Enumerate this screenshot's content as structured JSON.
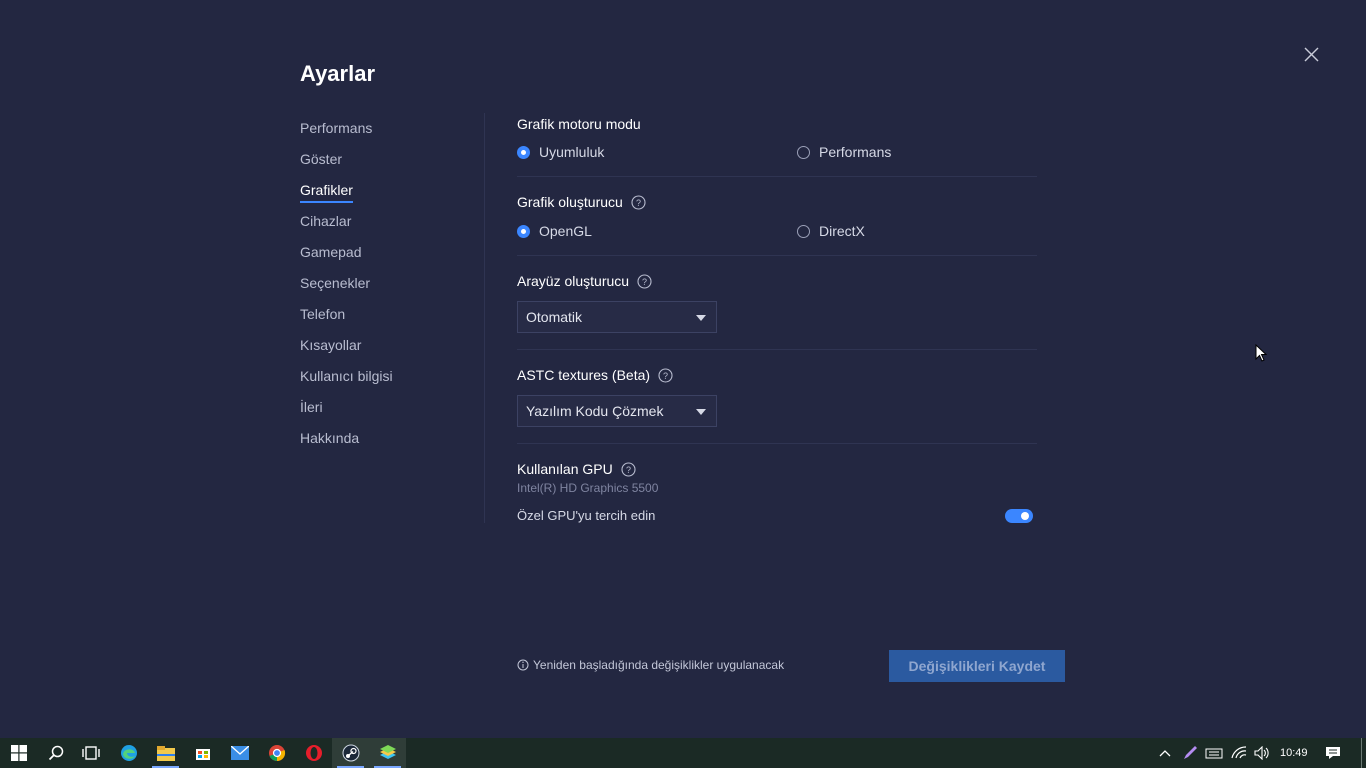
{
  "settings": {
    "title": "Ayarlar",
    "nav": [
      {
        "label": "Performans",
        "active": false
      },
      {
        "label": "Göster",
        "active": false
      },
      {
        "label": "Grafikler",
        "active": true
      },
      {
        "label": "Cihazlar",
        "active": false
      },
      {
        "label": "Gamepad",
        "active": false
      },
      {
        "label": "Seçenekler",
        "active": false
      },
      {
        "label": "Telefon",
        "active": false
      },
      {
        "label": "Kısayollar",
        "active": false
      },
      {
        "label": "Kullanıcı bilgisi",
        "active": false
      },
      {
        "label": "İleri",
        "active": false
      },
      {
        "label": "Hakkında",
        "active": false
      }
    ],
    "engine_mode": {
      "title": "Grafik motoru modu",
      "options": [
        "Uyumluluk",
        "Performans"
      ],
      "selected": "Uyumluluk"
    },
    "renderer": {
      "title": "Grafik oluşturucu",
      "options": [
        "OpenGL",
        "DirectX"
      ],
      "selected": "OpenGL"
    },
    "ui_renderer": {
      "title": "Arayüz oluşturucu",
      "value": "Otomatik"
    },
    "astc": {
      "title": "ASTC textures (Beta)",
      "value": "Yazılım Kodu Çözmek"
    },
    "gpu": {
      "title": "Kullanılan GPU",
      "name": "Intel(R) HD Graphics 5500",
      "prefer_label": "Özel GPU'yu tercih edin",
      "prefer_enabled": true
    },
    "footer_note": "Yeniden başladığında değişiklikler uygulanacak",
    "save_label": "Değişiklikleri Kaydet"
  },
  "colors": {
    "background": "#232741",
    "accent": "#3b86ff",
    "save_button": "#2b5aa0",
    "taskbar": "#1b2a25"
  },
  "taskbar": {
    "apps": [
      "windows-start-icon",
      "search-icon",
      "task-view-icon",
      "edge-icon",
      "file-explorer-icon",
      "store-icon",
      "mail-icon",
      "chrome-icon",
      "opera-icon",
      "steam-icon",
      "bluestacks-icon"
    ],
    "tray": [
      "chevron-up-icon",
      "pen-icon",
      "keyboard-icon",
      "wifi-icon",
      "volume-icon"
    ],
    "time": "10:49"
  }
}
